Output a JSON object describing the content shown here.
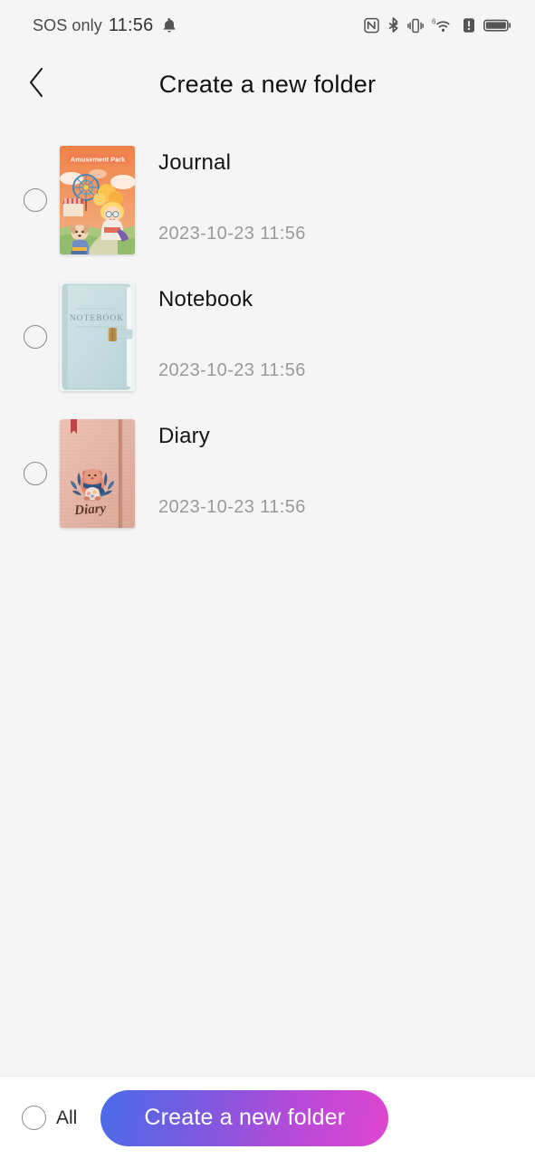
{
  "status_bar": {
    "carrier": "SOS only",
    "time": "11:56",
    "icons": [
      "bell-icon",
      "nfc-icon",
      "bluetooth-icon",
      "vibrate-icon",
      "wifi-6-icon",
      "alert-icon",
      "battery-icon"
    ],
    "wifi_generation": "6"
  },
  "header": {
    "back_icon": "chevron-left-icon",
    "title": "Create a new folder"
  },
  "list": {
    "items": [
      {
        "title": "Journal",
        "date": "2023-10-23 11:56",
        "selected": false,
        "cover": {
          "name": "amusement-park-cover",
          "caption": "Amusement Park",
          "sky": "#f0884e",
          "ground": "#a9c97e",
          "accent": "#ffd24d"
        }
      },
      {
        "title": "Notebook",
        "date": "2023-10-23 11:56",
        "selected": false,
        "cover": {
          "name": "mint-leather-notebook-cover",
          "caption": "NOTEBOOK",
          "body": "#c9dfe2",
          "clasp": "#b98c3e"
        }
      },
      {
        "title": "Diary",
        "date": "2023-10-23 11:56",
        "selected": false,
        "cover": {
          "name": "rose-glitter-diary-cover",
          "caption": "Diary",
          "body": "#e6b5a6",
          "bookmark": "#c4404a",
          "band": "#c98e7c"
        }
      }
    ]
  },
  "bottom_bar": {
    "select_all_label": "All",
    "select_all_checked": false,
    "primary_button": "Create a new folder",
    "gradient_start": "#4a6ce8",
    "gradient_end": "#e046cf"
  }
}
